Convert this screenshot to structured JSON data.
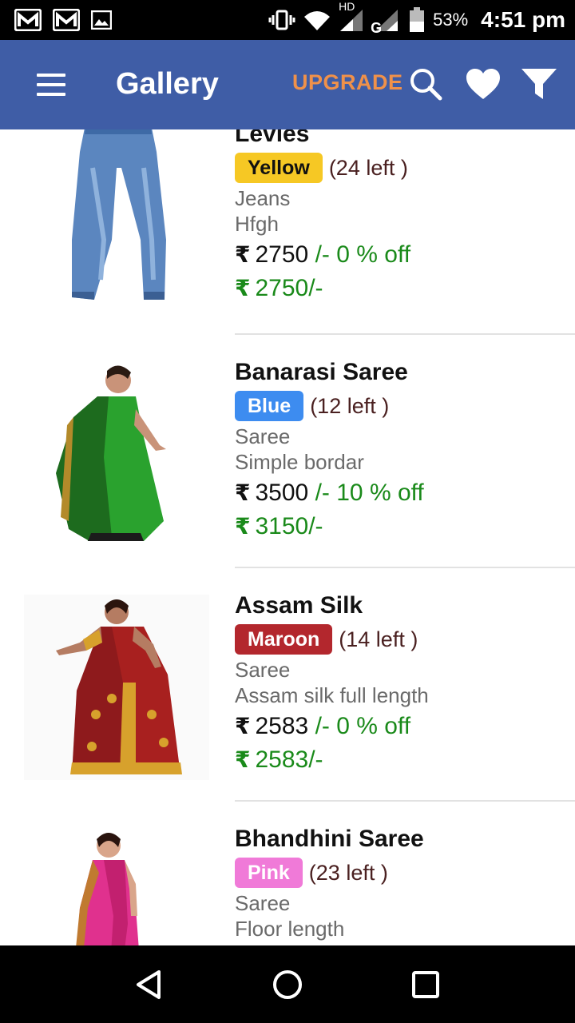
{
  "status_bar": {
    "network_label": "HD",
    "network_type": "G",
    "battery_percent": "53%",
    "time": "4:51 pm"
  },
  "app_bar": {
    "title": "Gallery",
    "upgrade_label": "UPGRADE"
  },
  "currency_symbol": "₹",
  "products": [
    {
      "name": "Levies",
      "color": "Yellow",
      "color_hex": "#f6c824",
      "color_text_hex": "#111111",
      "stock": "(24 left )",
      "category": "Jeans",
      "description": "Hfgh",
      "price": "2750",
      "discount": "/- 0 % off",
      "final_price": "2750/-",
      "image": "jeans"
    },
    {
      "name": "Banarasi Saree",
      "color": "Blue",
      "color_hex": "#3d8cf0",
      "color_text_hex": "#ffffff",
      "stock": "(12 left )",
      "category": "Saree",
      "description": "Simple bordar",
      "price": "3500",
      "discount": "/- 10 % off",
      "final_price": "3150/-",
      "image": "green-saree"
    },
    {
      "name": "Assam Silk",
      "color": "Maroon",
      "color_hex": "#b3272d",
      "color_text_hex": "#ffffff",
      "stock": "(14 left )",
      "category": "Saree",
      "description": "Assam silk full length",
      "price": "2583",
      "discount": "/- 0 % off",
      "final_price": "2583/-",
      "image": "maroon-saree"
    },
    {
      "name": "Bhandhini Saree",
      "color": "Pink",
      "color_hex": "#f07ad8",
      "color_text_hex": "#ffffff",
      "stock": "(23 left )",
      "category": "Saree",
      "description": "Floor length",
      "price": "",
      "discount": "",
      "final_price": "",
      "image": "pink-saree"
    }
  ]
}
